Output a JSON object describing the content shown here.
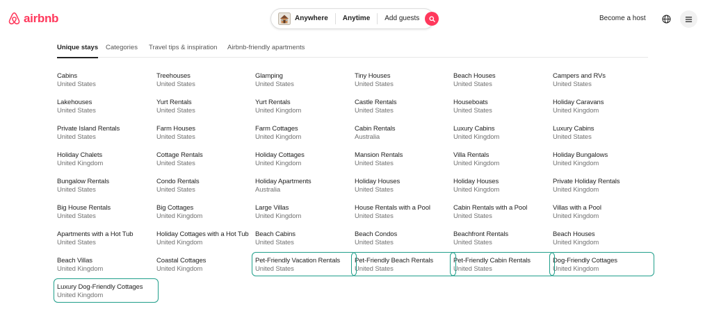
{
  "header": {
    "logo_text": "airbnb",
    "search": {
      "where": "Anywhere",
      "when": "Anytime",
      "guests": "Add guests"
    },
    "host_link": "Become a host",
    "icons": [
      "airbnb-logo-icon",
      "listing-thumbnail-icon",
      "search-icon",
      "globe-icon",
      "menu-icon"
    ],
    "brand_color": "#FF385C"
  },
  "tabs": [
    {
      "label": "Unique stays",
      "active": true
    },
    {
      "label": "Categories",
      "active": false
    },
    {
      "label": "Travel tips & inspiration",
      "active": false
    },
    {
      "label": "Airbnb-friendly apartments",
      "active": false
    }
  ],
  "highlight_color": "#1f9e8a",
  "grid": [
    [
      {
        "name": "Cabins",
        "location": "United States"
      },
      {
        "name": "Treehouses",
        "location": "United States"
      },
      {
        "name": "Glamping",
        "location": "United States"
      },
      {
        "name": "Tiny Houses",
        "location": "United States"
      },
      {
        "name": "Beach Houses",
        "location": "United States"
      },
      {
        "name": "Campers and RVs",
        "location": "United States"
      }
    ],
    [
      {
        "name": "Lakehouses",
        "location": "United States"
      },
      {
        "name": "Yurt Rentals",
        "location": "United States"
      },
      {
        "name": "Yurt Rentals",
        "location": "United Kingdom"
      },
      {
        "name": "Castle Rentals",
        "location": "United States"
      },
      {
        "name": "Houseboats",
        "location": "United States"
      },
      {
        "name": "Holiday Caravans",
        "location": "United Kingdom"
      }
    ],
    [
      {
        "name": "Private Island Rentals",
        "location": "United States"
      },
      {
        "name": "Farm Houses",
        "location": "United States"
      },
      {
        "name": "Farm Cottages",
        "location": "United Kingdom"
      },
      {
        "name": "Cabin Rentals",
        "location": "Australia"
      },
      {
        "name": "Luxury Cabins",
        "location": "United Kingdom"
      },
      {
        "name": "Luxury Cabins",
        "location": "United States"
      }
    ],
    [
      {
        "name": "Holiday Chalets",
        "location": "United Kingdom"
      },
      {
        "name": "Cottage Rentals",
        "location": "United States"
      },
      {
        "name": "Holiday Cottages",
        "location": "United Kingdom"
      },
      {
        "name": "Mansion Rentals",
        "location": "United States"
      },
      {
        "name": "Villa Rentals",
        "location": "United Kingdom"
      },
      {
        "name": "Holiday Bungalows",
        "location": "United Kingdom"
      }
    ],
    [
      {
        "name": "Bungalow Rentals",
        "location": "United States"
      },
      {
        "name": "Condo Rentals",
        "location": "United States"
      },
      {
        "name": "Holiday Apartments",
        "location": "Australia"
      },
      {
        "name": "Holiday Houses",
        "location": "United States"
      },
      {
        "name": "Holiday Houses",
        "location": "United Kingdom"
      },
      {
        "name": "Private Holiday Rentals",
        "location": "United Kingdom"
      }
    ],
    [
      {
        "name": "Big House Rentals",
        "location": "United States"
      },
      {
        "name": "Big Cottages",
        "location": "United Kingdom"
      },
      {
        "name": "Large Villas",
        "location": "United Kingdom"
      },
      {
        "name": "House Rentals with a Pool",
        "location": "United States"
      },
      {
        "name": "Cabin Rentals with a Pool",
        "location": "United States"
      },
      {
        "name": "Villas with a Pool",
        "location": "United Kingdom"
      }
    ],
    [
      {
        "name": "Apartments with a Hot Tub",
        "location": "United States"
      },
      {
        "name": "Holiday Cottages with a Hot Tub",
        "location": "United Kingdom"
      },
      {
        "name": "Beach Cabins",
        "location": "United States"
      },
      {
        "name": "Beach Condos",
        "location": "United States"
      },
      {
        "name": "Beachfront Rentals",
        "location": "United States"
      },
      {
        "name": "Beach Houses",
        "location": "United Kingdom"
      }
    ],
    [
      {
        "name": "Beach Villas",
        "location": "United Kingdom"
      },
      {
        "name": "Coastal Cottages",
        "location": "United Kingdom"
      },
      {
        "name": "Pet-Friendly Vacation Rentals",
        "location": "United States",
        "highlighted": true
      },
      {
        "name": "Pet-Friendly Beach Rentals",
        "location": "United States",
        "highlighted": true
      },
      {
        "name": "Pet-Friendly Cabin Rentals",
        "location": "United States",
        "highlighted": true
      },
      {
        "name": "Dog-Friendly Cottages",
        "location": "United Kingdom",
        "highlighted": true
      }
    ],
    [
      {
        "name": "Luxury Dog-Friendly Cottages",
        "location": "United Kingdom",
        "highlighted": true
      }
    ]
  ]
}
